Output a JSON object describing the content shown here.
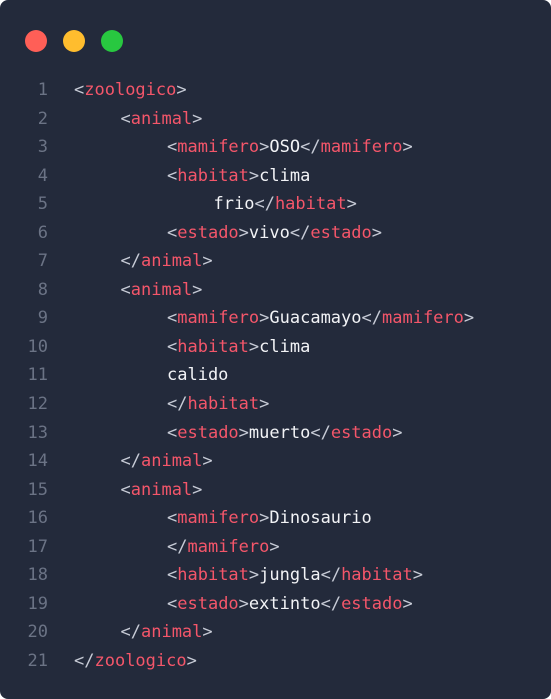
{
  "colors": {
    "background": "#232a3b",
    "traffic_red": "#ff5f57",
    "traffic_yellow": "#ffbd2e",
    "traffic_green": "#28c840",
    "tag": "#f4566a",
    "bracket": "#c7cbd6",
    "text": "#f2f3f6",
    "line_number": "#6b7385"
  },
  "window_controls": [
    {
      "name": "close-dot",
      "color_key": "traffic_red"
    },
    {
      "name": "minimize-dot",
      "color_key": "traffic_yellow"
    },
    {
      "name": "maximize-dot",
      "color_key": "traffic_green"
    }
  ],
  "code": {
    "lines": [
      {
        "number": "1",
        "indent": 0,
        "tokens": [
          [
            "p",
            "<"
          ],
          [
            "t",
            "zoologico"
          ],
          [
            "p",
            ">"
          ]
        ]
      },
      {
        "number": "2",
        "indent": 1,
        "tokens": [
          [
            "p",
            "<"
          ],
          [
            "t",
            "animal"
          ],
          [
            "p",
            ">"
          ]
        ]
      },
      {
        "number": "3",
        "indent": 2,
        "tokens": [
          [
            "p",
            "<"
          ],
          [
            "t",
            "mamifero"
          ],
          [
            "p",
            ">"
          ],
          [
            "x",
            "OSO"
          ],
          [
            "p",
            "</"
          ],
          [
            "t",
            "mamifero"
          ],
          [
            "p",
            ">"
          ]
        ]
      },
      {
        "number": "4",
        "indent": 2,
        "tokens": [
          [
            "p",
            "<"
          ],
          [
            "t",
            "habitat"
          ],
          [
            "p",
            ">"
          ],
          [
            "x",
            "clima"
          ]
        ]
      },
      {
        "number": "5",
        "indent": 3,
        "tokens": [
          [
            "x",
            "frio"
          ],
          [
            "p",
            "</"
          ],
          [
            "t",
            "habitat"
          ],
          [
            "p",
            ">"
          ]
        ]
      },
      {
        "number": "6",
        "indent": 2,
        "tokens": [
          [
            "p",
            "<"
          ],
          [
            "t",
            "estado"
          ],
          [
            "p",
            ">"
          ],
          [
            "x",
            "vivo"
          ],
          [
            "p",
            "</"
          ],
          [
            "t",
            "estado"
          ],
          [
            "p",
            ">"
          ]
        ]
      },
      {
        "number": "7",
        "indent": 1,
        "tokens": [
          [
            "p",
            "</"
          ],
          [
            "t",
            "animal"
          ],
          [
            "p",
            ">"
          ]
        ]
      },
      {
        "number": "8",
        "indent": 1,
        "tokens": [
          [
            "p",
            "<"
          ],
          [
            "t",
            "animal"
          ],
          [
            "p",
            ">"
          ]
        ]
      },
      {
        "number": "9",
        "indent": 2,
        "tokens": [
          [
            "p",
            "<"
          ],
          [
            "t",
            "mamifero"
          ],
          [
            "p",
            ">"
          ],
          [
            "x",
            "Guacamayo"
          ],
          [
            "p",
            "</"
          ],
          [
            "t",
            "mamifero"
          ],
          [
            "p",
            ">"
          ]
        ]
      },
      {
        "number": "10",
        "indent": 2,
        "tokens": [
          [
            "p",
            "<"
          ],
          [
            "t",
            "habitat"
          ],
          [
            "p",
            ">"
          ],
          [
            "x",
            "clima"
          ]
        ]
      },
      {
        "number": "11",
        "indent": 2,
        "tokens": [
          [
            "x",
            "calido"
          ]
        ]
      },
      {
        "number": "12",
        "indent": 2,
        "tokens": [
          [
            "p",
            "</"
          ],
          [
            "t",
            "habitat"
          ],
          [
            "p",
            ">"
          ]
        ]
      },
      {
        "number": "13",
        "indent": 2,
        "tokens": [
          [
            "p",
            "<"
          ],
          [
            "t",
            "estado"
          ],
          [
            "p",
            ">"
          ],
          [
            "x",
            "muerto"
          ],
          [
            "p",
            "</"
          ],
          [
            "t",
            "estado"
          ],
          [
            "p",
            ">"
          ]
        ]
      },
      {
        "number": "14",
        "indent": 1,
        "tokens": [
          [
            "p",
            "</"
          ],
          [
            "t",
            "animal"
          ],
          [
            "p",
            ">"
          ]
        ]
      },
      {
        "number": "15",
        "indent": 1,
        "tokens": [
          [
            "p",
            "<"
          ],
          [
            "t",
            "animal"
          ],
          [
            "p",
            ">"
          ]
        ]
      },
      {
        "number": "16",
        "indent": 2,
        "tokens": [
          [
            "p",
            "<"
          ],
          [
            "t",
            "mamifero"
          ],
          [
            "p",
            ">"
          ],
          [
            "x",
            "Dinosaurio"
          ]
        ]
      },
      {
        "number": "17",
        "indent": 2,
        "tokens": [
          [
            "p",
            "</"
          ],
          [
            "t",
            "mamifero"
          ],
          [
            "p",
            ">"
          ]
        ]
      },
      {
        "number": "18",
        "indent": 2,
        "tokens": [
          [
            "p",
            "<"
          ],
          [
            "t",
            "habitat"
          ],
          [
            "p",
            ">"
          ],
          [
            "x",
            "jungla"
          ],
          [
            "p",
            "</"
          ],
          [
            "t",
            "habitat"
          ],
          [
            "p",
            ">"
          ]
        ]
      },
      {
        "number": "19",
        "indent": 2,
        "tokens": [
          [
            "p",
            "<"
          ],
          [
            "t",
            "estado"
          ],
          [
            "p",
            ">"
          ],
          [
            "x",
            "extinto"
          ],
          [
            "p",
            "</"
          ],
          [
            "t",
            "estado"
          ],
          [
            "p",
            ">"
          ]
        ]
      },
      {
        "number": "20",
        "indent": 1,
        "tokens": [
          [
            "p",
            "</"
          ],
          [
            "t",
            "animal"
          ],
          [
            "p",
            ">"
          ]
        ]
      },
      {
        "number": "21",
        "indent": 0,
        "tokens": [
          [
            "p",
            "</"
          ],
          [
            "t",
            "zoologico"
          ],
          [
            "p",
            ">"
          ]
        ]
      }
    ]
  }
}
